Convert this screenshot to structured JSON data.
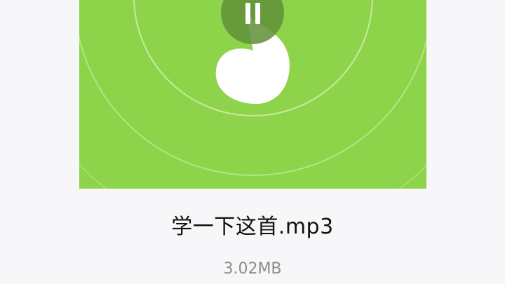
{
  "player": {
    "cover_color": "#8dd44a",
    "cover_icon": "music-note-icon",
    "control_icon": "pause-icon",
    "state": "playing"
  },
  "file": {
    "name": "学一下这首.mp3",
    "size": "3.02MB"
  }
}
